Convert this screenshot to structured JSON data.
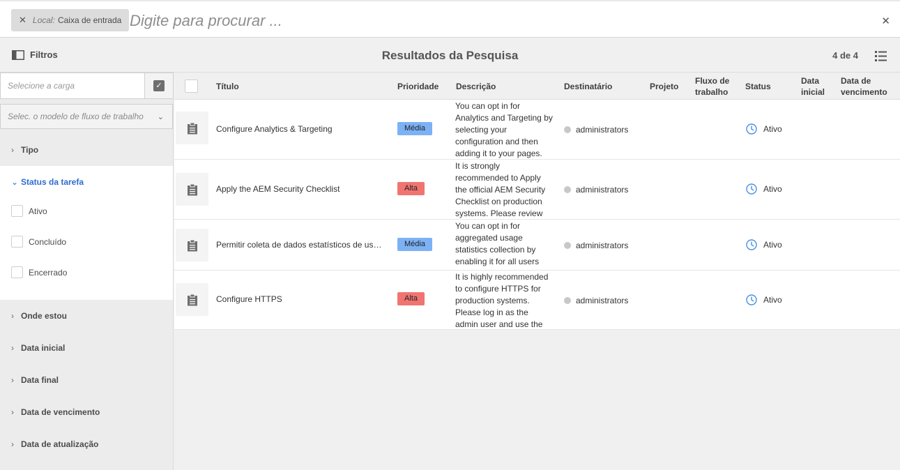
{
  "search": {
    "location_prefix": "Local:",
    "location_value": "Caixa de entrada",
    "placeholder": "Digite para procurar ..."
  },
  "header": {
    "filters_label": "Filtros",
    "title": "Resultados da Pesquisa",
    "count": "4 de 4"
  },
  "sidebar": {
    "payload_placeholder": "Selecione a carga",
    "workflow_model_placeholder": "Selec. o modelo de fluxo de trabalho",
    "sections": {
      "type": "Tipo",
      "task_status": "Status da tarefa",
      "where": "Onde estou",
      "start_date": "Data inicial",
      "end_date": "Data final",
      "due_date": "Data de vencimento",
      "update_date": "Data de atualização"
    },
    "status_options": [
      "Ativo",
      "Concluído",
      "Encerrado"
    ]
  },
  "table": {
    "columns": {
      "title": "Título",
      "priority": "Prioridade",
      "description": "Descrição",
      "assignee": "Destinatário",
      "project": "Projeto",
      "workflow_1": "Fluxo de",
      "workflow_2": "trabalho",
      "status": "Status",
      "start_1": "Data",
      "start_2": "inicial",
      "due_1": "Data de",
      "due_2": "vencimento"
    },
    "rows": [
      {
        "title": "Configure Analytics & Targeting",
        "priority": "Média",
        "description": "You can opt in for Analytics and Targeting by selecting your configuration and then adding it to your pages.",
        "assignee": "administrators",
        "status": "Ativo"
      },
      {
        "title": "Apply the AEM Security Checklist",
        "priority": "Alta",
        "description": "It is strongly recommended to Apply the official AEM Security Checklist on production systems. Please review",
        "assignee": "administrators",
        "status": "Ativo"
      },
      {
        "title": "Permitir coleta de dados estatísticos de uso...",
        "priority": "Média",
        "description": "You can opt in for aggregated usage statistics collection by enabling it for all users",
        "assignee": "administrators",
        "status": "Ativo"
      },
      {
        "title": "Configure HTTPS",
        "priority": "Alta",
        "description": "It is highly recommended to configure HTTPS for production systems. Please log in as the admin user and use the",
        "assignee": "administrators",
        "status": "Ativo"
      }
    ]
  },
  "colors": {
    "priority_media": "#7cb2f5",
    "priority_alta": "#f07571",
    "accent": "#2d6cd2"
  }
}
